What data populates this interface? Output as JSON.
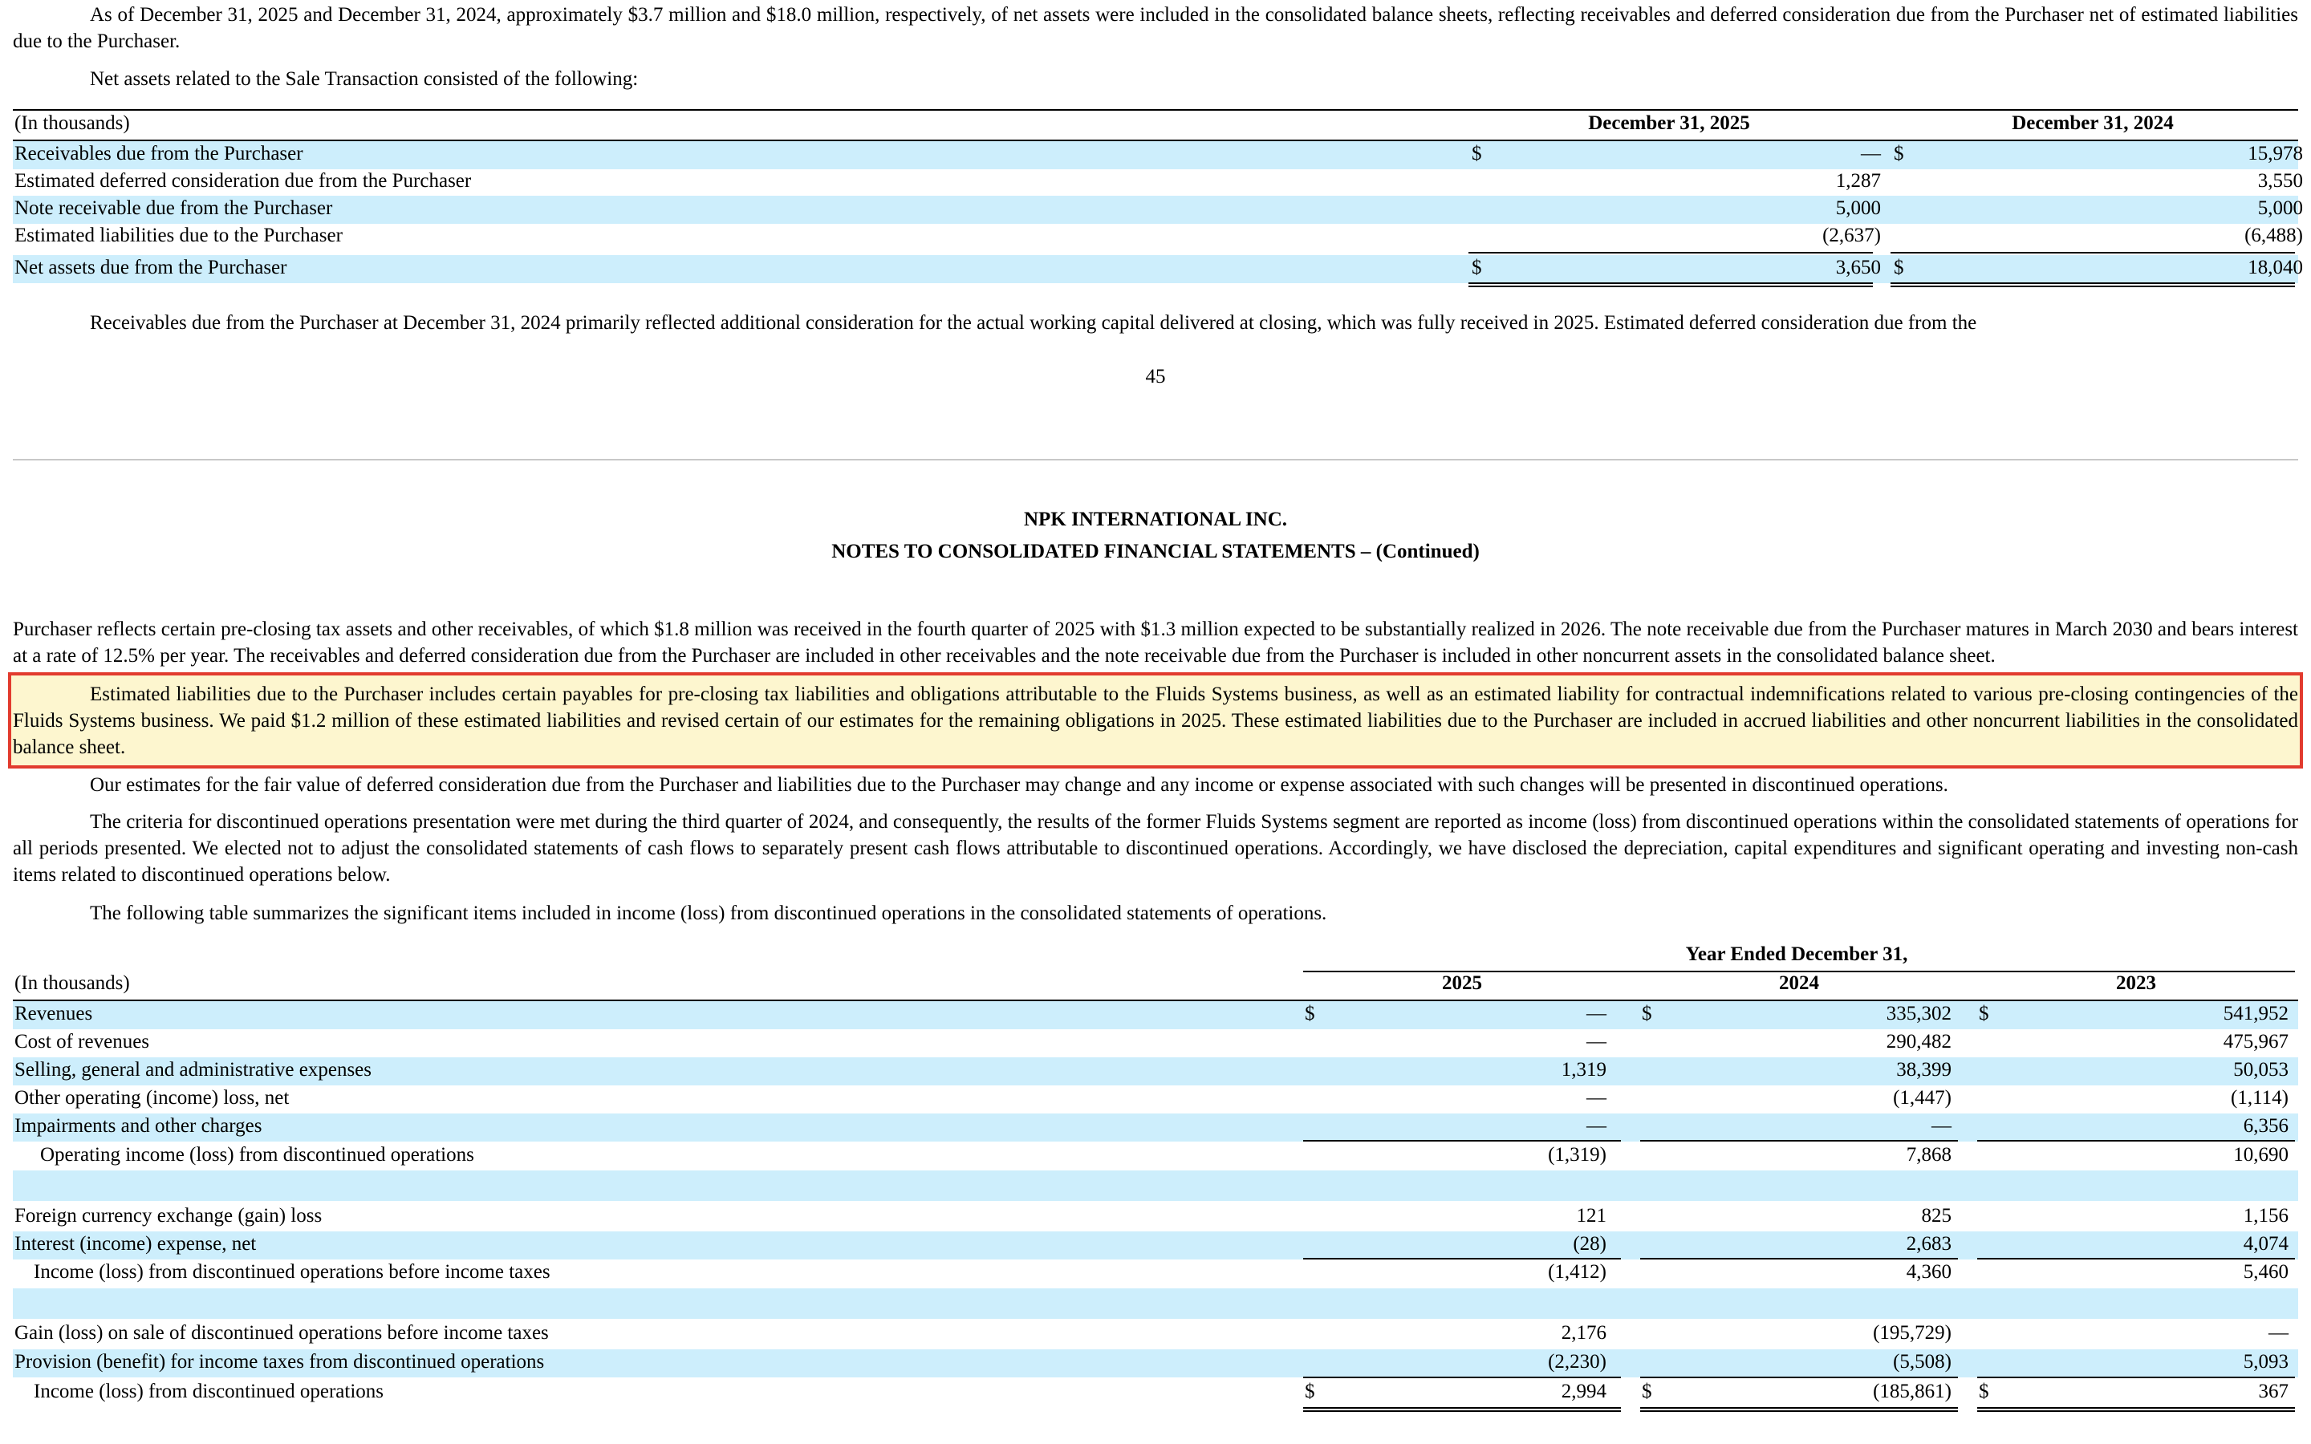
{
  "top_paragraph": "As of December 31, 2025 and December 31, 2024, approximately $3.7 million and $18.0 million, respectively, of net assets were included in the consolidated balance sheets, reflecting receivables and deferred consideration due from the Purchaser net of estimated liabilities due to the Purchaser.",
  "net_assets_intro": "Net assets related to the Sale Transaction consisted of the following:",
  "table1": {
    "unit_label": "(In thousands)",
    "col1": "December 31, 2025",
    "col2": "December 31, 2024",
    "currency": "$",
    "rows": [
      {
        "label": "Receivables due from the Purchaser",
        "v1": "—",
        "v2": "15,978"
      },
      {
        "label": "Estimated deferred consideration due from the Purchaser",
        "v1": "1,287",
        "v2": "3,550"
      },
      {
        "label": "Note receivable due from the Purchaser",
        "v1": "5,000",
        "v2": "5,000"
      },
      {
        "label": "Estimated liabilities due to the Purchaser",
        "v1": "(2,637)",
        "v2": "(6,488)"
      },
      {
        "label": "Net assets due from the Purchaser",
        "v1": "3,650",
        "v2": "18,040"
      }
    ]
  },
  "receivables_paragraph": "Receivables due from the Purchaser at December 31, 2024 primarily reflected additional consideration for the actual working capital delivered at closing, which was fully received in 2025. Estimated deferred consideration due from the",
  "page_number": "45",
  "company_name": "NPK INTERNATIONAL INC.",
  "notes_title": "NOTES TO CONSOLIDATED FINANCIAL STATEMENTS – (Continued)",
  "purchaser_paragraph": "Purchaser reflects certain pre-closing tax assets and other receivables, of which $1.8 million was received in the fourth quarter of 2025 with $1.3 million expected to be substantially realized in 2026. The note receivable due from the Purchaser matures in March 2030 and bears interest at a rate of 12.5% per year. The receivables and deferred consideration due from the Purchaser are included in other receivables and the note receivable due from the Purchaser is included in other noncurrent assets in the consolidated balance sheet.",
  "highlighted_paragraph": "Estimated liabilities due to the Purchaser includes certain payables for pre-closing tax liabilities and obligations attributable to the Fluids Systems business, as well as an estimated liability for contractual indemnifications related to various pre-closing contingencies of the Fluids Systems business. We paid $1.2 million of these estimated liabilities and revised certain of our estimates for the remaining obligations in 2025. These estimated liabilities due to the Purchaser are included in accrued liabilities and other noncurrent liabilities in the consolidated balance sheet.",
  "estimates_paragraph": "Our estimates for the fair value of deferred consideration due from the Purchaser and liabilities due to the Purchaser may change and any income or expense associated with such changes will be presented in discontinued operations.",
  "criteria_paragraph": "The criteria for discontinued operations presentation were met during the third quarter of 2024, and consequently, the results of the former Fluids Systems segment are reported as income (loss) from discontinued operations within the consolidated statements of operations for all periods presented. We elected not to adjust the consolidated statements of cash flows to separately present cash flows attributable to discontinued operations. Accordingly, we have disclosed the depreciation, capital expenditures and significant operating and investing non-cash items related to discontinued operations below.",
  "summary_paragraph": "The following table summarizes the significant items included in income (loss) from discontinued operations in the consolidated statements of operations.",
  "table2": {
    "unit_label": "(In thousands)",
    "period_header": "Year Ended December 31,",
    "col1": "2025",
    "col2": "2024",
    "col3": "2023",
    "currency": "$",
    "rows": [
      {
        "label": "Revenues",
        "v1": "—",
        "v2": "335,302",
        "v3": "541,952"
      },
      {
        "label": "Cost of revenues",
        "v1": "—",
        "v2": "290,482",
        "v3": "475,967"
      },
      {
        "label": "Selling, general and administrative expenses",
        "v1": "1,319",
        "v2": "38,399",
        "v3": "50,053"
      },
      {
        "label": "Other operating (income) loss, net",
        "v1": "—",
        "v2": "(1,447)",
        "v3": "(1,114)"
      },
      {
        "label": "Impairments and other charges",
        "v1": "—",
        "v2": "—",
        "v3": "6,356"
      },
      {
        "label": "Operating income (loss) from discontinued operations",
        "v1": "(1,319)",
        "v2": "7,868",
        "v3": "10,690"
      },
      {
        "label": "",
        "v1": "",
        "v2": "",
        "v3": ""
      },
      {
        "label": "Foreign currency exchange (gain) loss",
        "v1": "121",
        "v2": "825",
        "v3": "1,156"
      },
      {
        "label": "Interest (income) expense, net",
        "v1": "(28)",
        "v2": "2,683",
        "v3": "4,074"
      },
      {
        "label": "Income (loss) from discontinued operations before income taxes",
        "v1": "(1,412)",
        "v2": "4,360",
        "v3": "5,460"
      },
      {
        "label": "",
        "v1": "",
        "v2": "",
        "v3": ""
      },
      {
        "label": "Gain (loss) on sale of discontinued operations before income taxes",
        "v1": "2,176",
        "v2": "(195,729)",
        "v3": "—"
      },
      {
        "label": "Provision (benefit) for income taxes from discontinued operations",
        "v1": "(2,230)",
        "v2": "(5,508)",
        "v3": "5,093"
      },
      {
        "label": "Income (loss) from discontinued operations",
        "v1": "2,994",
        "v2": "(185,861)",
        "v3": "367"
      }
    ]
  }
}
